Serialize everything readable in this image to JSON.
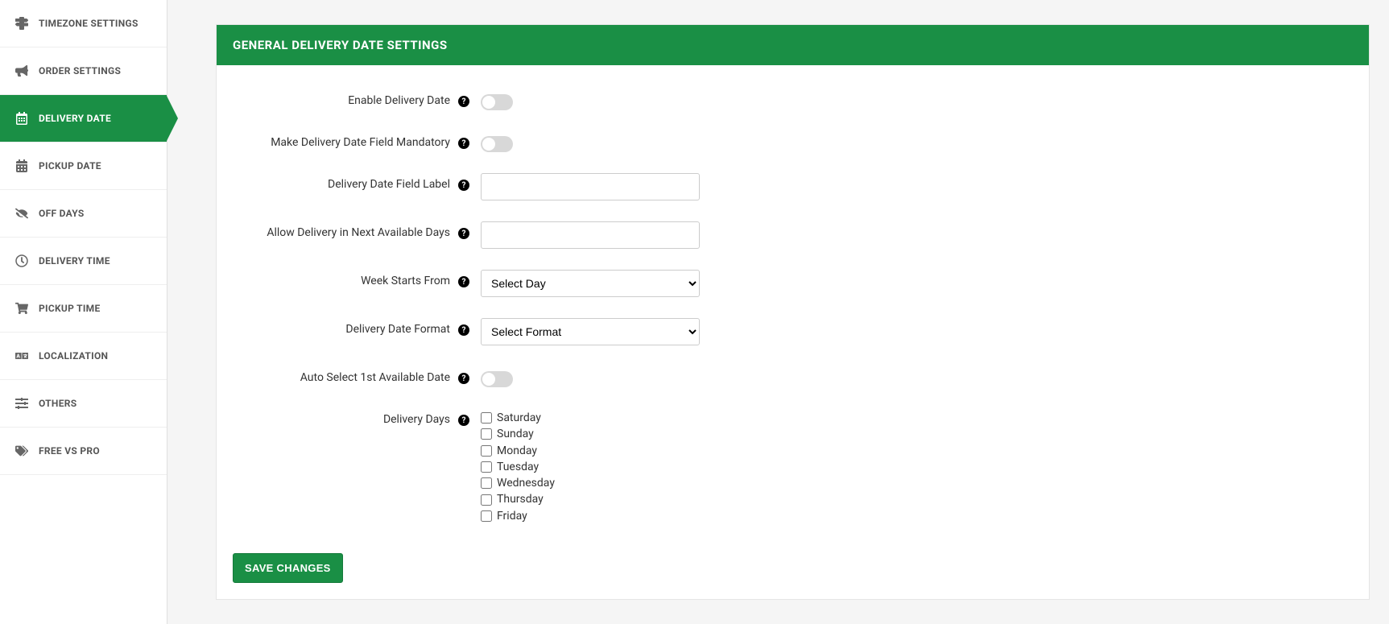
{
  "sidebar": {
    "items": [
      {
        "label": "TIMEZONE SETTINGS"
      },
      {
        "label": "ORDER SETTINGS"
      },
      {
        "label": "DELIVERY DATE"
      },
      {
        "label": "PICKUP DATE"
      },
      {
        "label": "OFF DAYS"
      },
      {
        "label": "DELIVERY TIME"
      },
      {
        "label": "PICKUP TIME"
      },
      {
        "label": "LOCALIZATION"
      },
      {
        "label": "OTHERS"
      },
      {
        "label": "FREE VS PRO"
      }
    ]
  },
  "panel": {
    "title": "GENERAL DELIVERY DATE SETTINGS"
  },
  "form": {
    "enable_label": "Enable Delivery Date",
    "mandatory_label": "Make Delivery Date Field Mandatory",
    "field_label_label": "Delivery Date Field Label",
    "field_label_value": "",
    "allow_next_label": "Allow Delivery in Next Available Days",
    "allow_next_value": "",
    "week_starts_label": "Week Starts From",
    "week_starts_selected": "Select Day",
    "date_format_label": "Delivery Date Format",
    "date_format_selected": "Select Format",
    "auto_select_label": "Auto Select 1st Available Date",
    "delivery_days_label": "Delivery Days",
    "days": [
      "Saturday",
      "Sunday",
      "Monday",
      "Tuesday",
      "Wednesday",
      "Thursday",
      "Friday"
    ]
  },
  "actions": {
    "save": "SAVE CHANGES"
  },
  "help": "?"
}
